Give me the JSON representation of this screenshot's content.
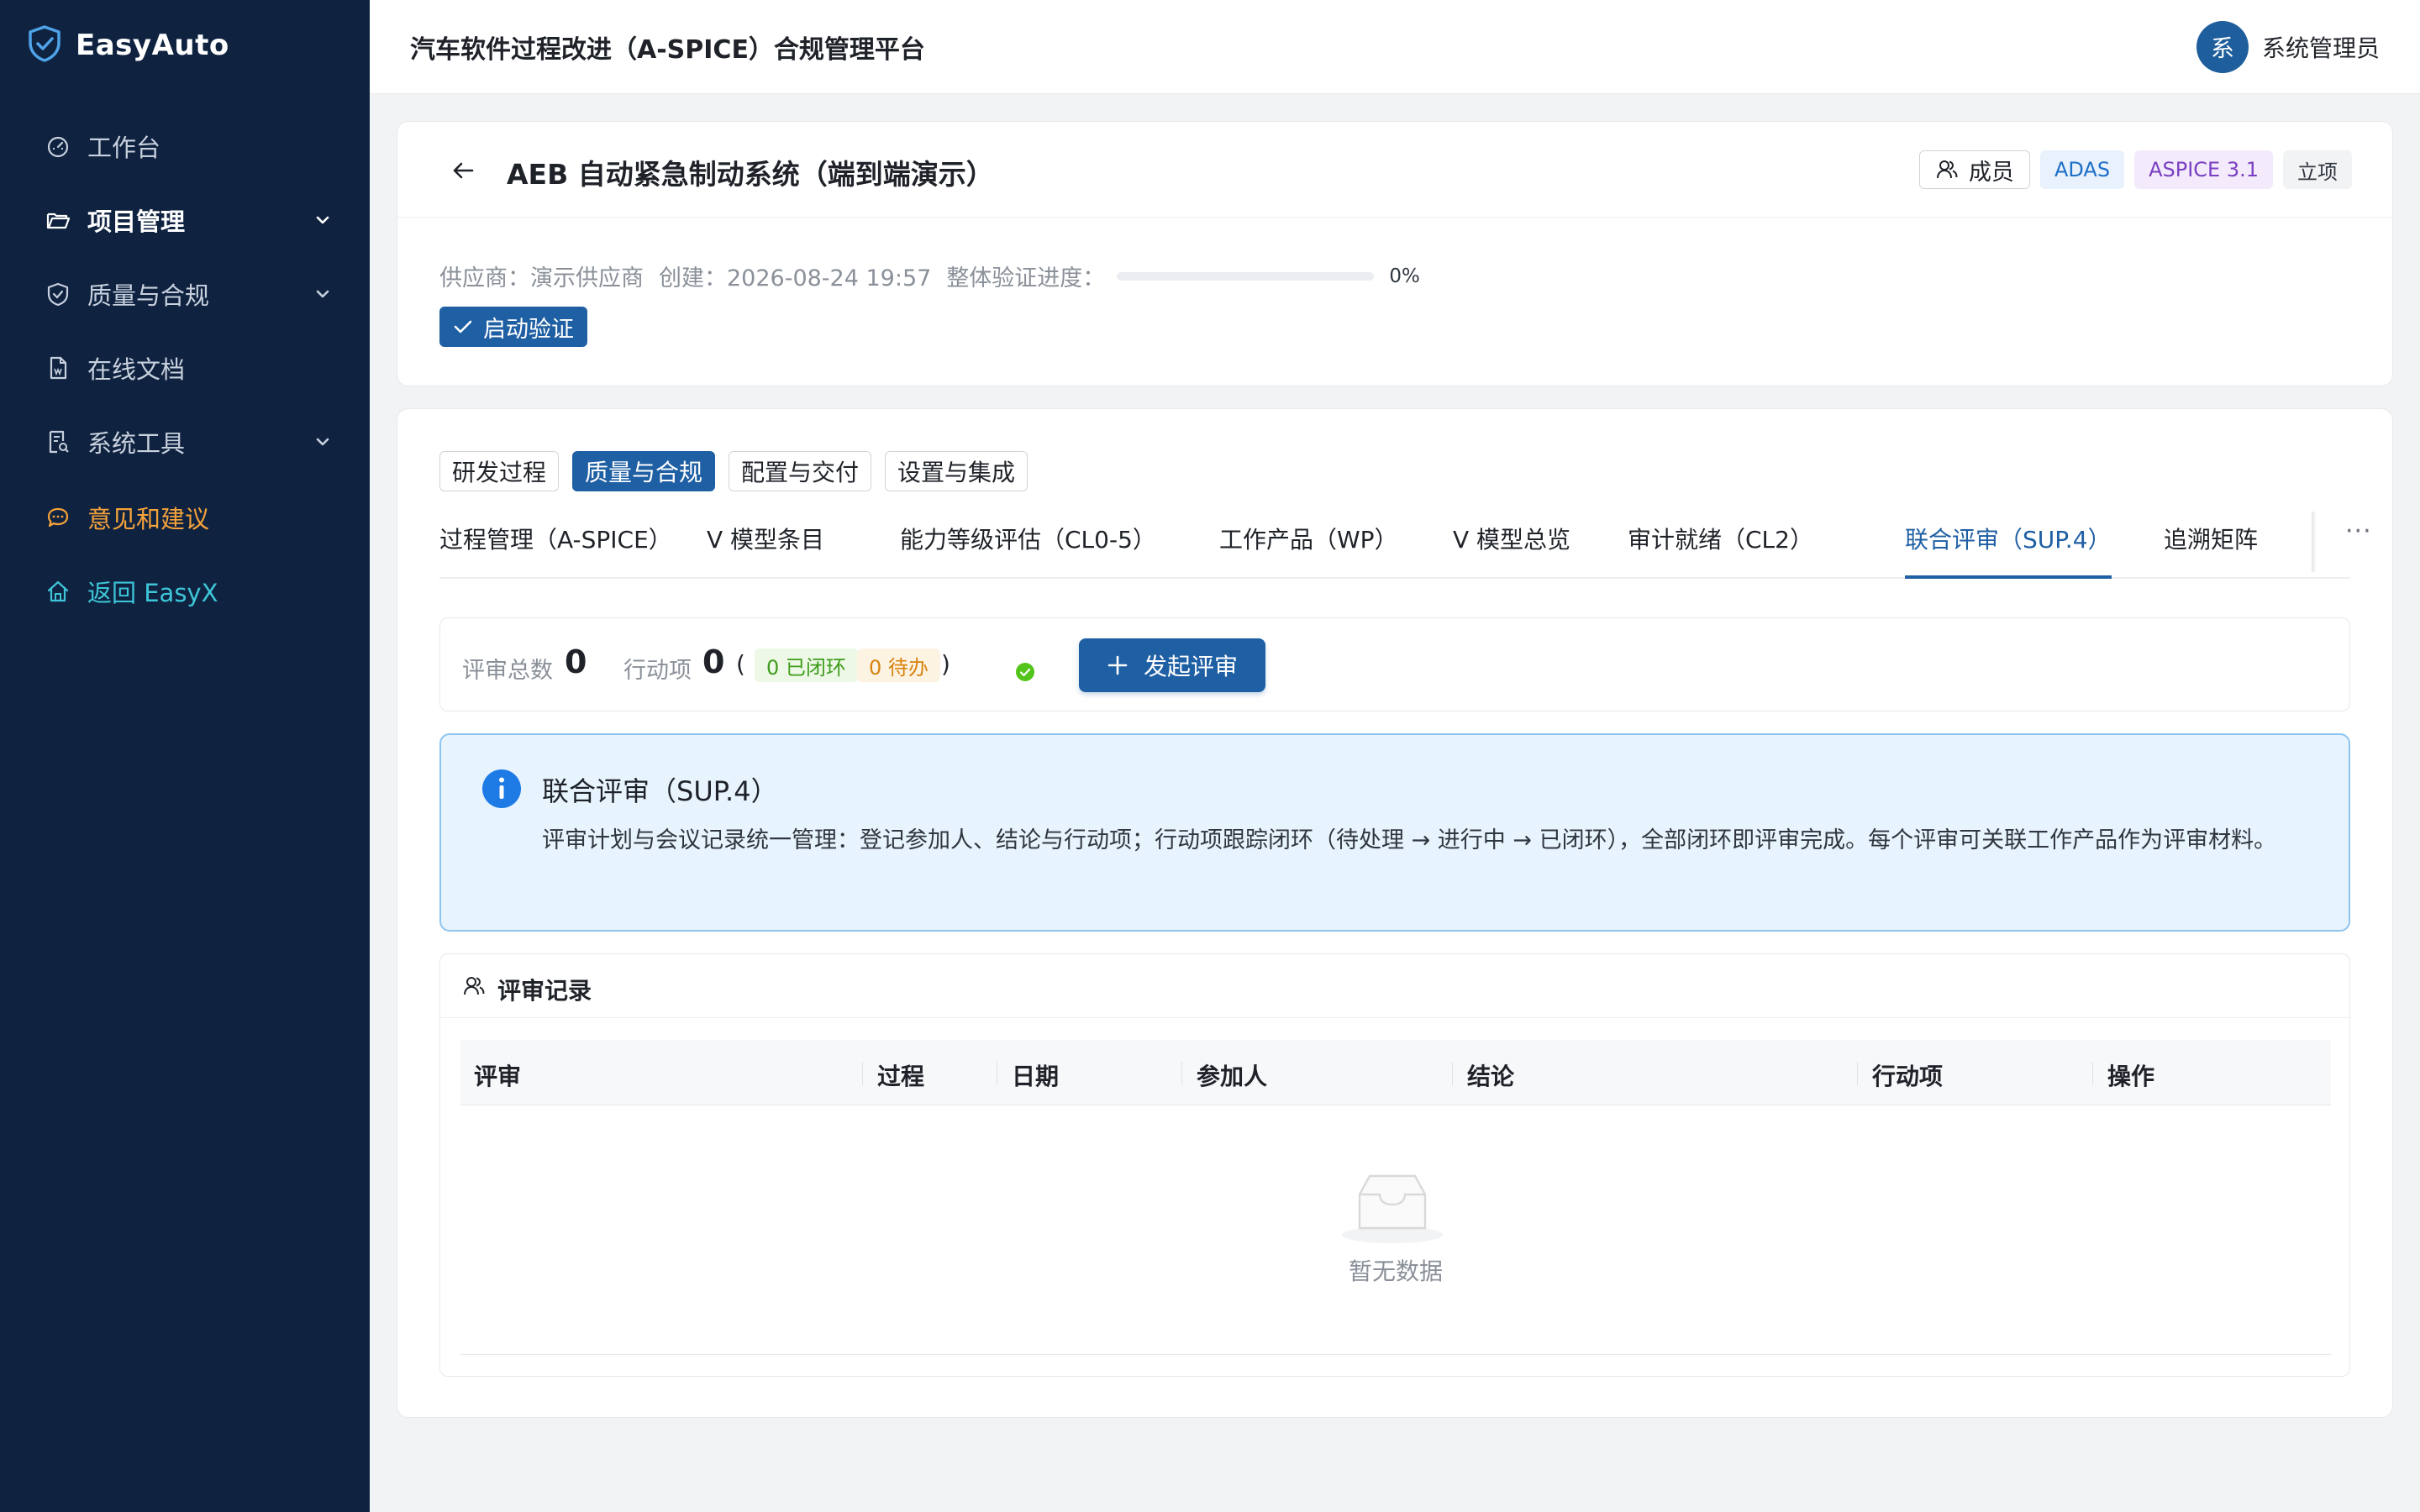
{
  "sidebar": {
    "brand": "EasyAuto",
    "items": [
      {
        "label": "工作台"
      },
      {
        "label": "项目管理"
      },
      {
        "label": "质量与合规"
      },
      {
        "label": "在线文档"
      },
      {
        "label": "系统工具"
      },
      {
        "label": "意见和建议"
      },
      {
        "label": "返回 EasyX"
      }
    ]
  },
  "header": {
    "title": "汽车软件过程改进（A-SPICE）合规管理平台",
    "avatar_char": "系",
    "user_name": "系统管理员"
  },
  "project": {
    "title": "AEB 自动紧急制动系统（端到端演示）",
    "member_label": "成员",
    "tags": [
      "ADAS",
      "ASPICE 3.1",
      "立项"
    ],
    "supplier": "供应商：演示供应商",
    "created": "创建：2026-08-24 19:57",
    "progress_label": "整体验证进度：",
    "progress_value": 0,
    "progress_text": "0%",
    "start_button": "启动验证"
  },
  "group_tabs": [
    "研发过程",
    "质量与合规",
    "配置与交付",
    "设置与集成"
  ],
  "sub_tabs": [
    "过程管理（A-SPICE）",
    "V 模型条目",
    "能力等级评估（CL0-5）",
    "工作产品（WP）",
    "V 模型总览",
    "审计就绪（CL2）",
    "联合评审（SUP.4）",
    "追溯矩阵"
  ],
  "more": "···",
  "stats": {
    "total_label": "评审总数",
    "total_value": "0",
    "actions_label": "行动项",
    "actions_value": "0",
    "paren_open": "(",
    "closed": "0 已闭环",
    "pending": "0 待办",
    "paren_close": ")",
    "new_button": "发起评审"
  },
  "info": {
    "title": "联合评审（SUP.4）",
    "text": "评审计划与会议记录统一管理：登记参加人、结论与行动项；行动项跟踪闭环（待处理 → 进行中 → 已闭环），全部闭环即评审完成。每个评审可关联工作产品作为评审材料。"
  },
  "records": {
    "title": "评审记录",
    "columns": [
      "评审",
      "过程",
      "日期",
      "参加人",
      "结论",
      "行动项",
      "操作"
    ],
    "empty": "暂无数据"
  },
  "colors": {
    "sidebar": "#0f2341",
    "primary": "#1f5fa3",
    "info_bg": "#e7f3fd"
  }
}
